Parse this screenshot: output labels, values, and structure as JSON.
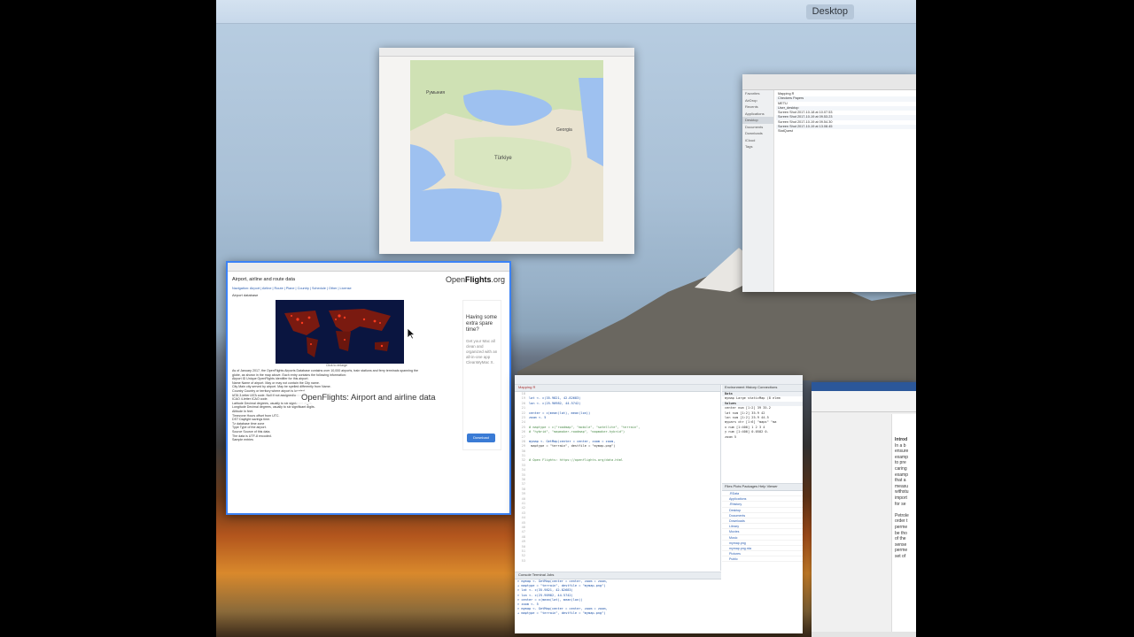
{
  "topbar": {
    "space_label": "Desktop"
  },
  "map_window": {
    "title": "",
    "labels": {
      "turkey": "Türkiye",
      "romania": "Румыния",
      "georgia": "Georgia"
    }
  },
  "finder": {
    "sidebar": [
      "Favorites",
      "AirDrop",
      "Recents",
      "Applications",
      "Desktop",
      "Documents",
      "Downloads",
      "iCloud",
      "Tags"
    ],
    "items": [
      "Mapping R",
      "Checkers Papers",
      "METU",
      "User_desktop",
      "Screen Shot 2017-10-18 at 10.07.53",
      "Screen Shot 2017-10-19 at 09.53.23",
      "Screen Shot 2017-10-19 at 09.54.30",
      "Screen Shot 2017-10-19 at 13.08.45",
      "StatQuest"
    ]
  },
  "openflights": {
    "page_title": "Airport, airline and route data",
    "logo_prefix": "Open",
    "logo_bold": "Flights",
    "logo_suffix": ".org",
    "nav": "Navigation: Airport | Airline | Route | Plane | Country | Schedule | Other | License",
    "section": "Airport database",
    "caption": "Click to enlarge",
    "body_lines": [
      "As of January 2017, the OpenFlights Airports Database contains over 10,000 airports, train stations and ferry terminals spanning the",
      "globe, as shown in the map above. Each entry contains the following information:",
      "Airport ID   Unique OpenFlights identifier for this airport.",
      "Name         Name of airport. May or may not contain the City name.",
      "City         Main city served by airport. May be spelled differently from Name.",
      "Country      Country or territory where airport is located.",
      "IATA         3-letter IATA code. Null if not assigned/unknown.",
      "ICAO         4-letter ICAO code.",
      "Latitude     Decimal degrees, usually to six significant digits.",
      "Longitude    Decimal degrees, usually to six significant digits.",
      "Altitude     In feet.",
      "Timezone     Hours offset from UTC.",
      "DST          Daylight savings time.",
      "Tz database time zone",
      "Type         Type of the airport.",
      "Source       Source of this data.",
      "The data is UTF-8 encoded.",
      "Sample entries"
    ],
    "ad_heading": "Having some extra spare time?",
    "ad_text": "Get your Mac all clean and organized with an all-in-one app CleanMyMac X.",
    "ad_button": "Download",
    "overlay_label": "OpenFlights: Airport and airline data"
  },
  "rstudio": {
    "editor_tab": "Mapping R",
    "code_lines": [
      {
        "n": "18",
        "t": ""
      },
      {
        "n": "19",
        "t": "lat <- c(35.9821, 42.82683)"
      },
      {
        "n": "20",
        "t": "lon <- c(25.90982, 44.5742)"
      },
      {
        "n": "21",
        "t": ""
      },
      {
        "n": "22",
        "t": "center = c(mean(lat), mean(lon))"
      },
      {
        "n": "23",
        "t": "zoom <- 5"
      },
      {
        "n": "24",
        "t": ""
      },
      {
        "n": "25",
        "t": "# maptype = c(\"roadmap\", \"mobile\", \"satellite\", \"terrain\","
      },
      {
        "n": "26",
        "t": "# \"hybrid\", \"mapmaker-roadmap\", \"mapmaker-hybrid\")"
      },
      {
        "n": "27",
        "t": ""
      },
      {
        "n": "28",
        "t": "mymap <- GetMap(center = center, zoom = zoom,"
      },
      {
        "n": "29",
        "t": "              maptype = \"terrain\", destfile = \"mymap.png\")"
      },
      {
        "n": "30",
        "t": ""
      },
      {
        "n": "31",
        "t": ""
      },
      {
        "n": "32",
        "t": "# Open Flights:  https://openflights.org/data.html"
      },
      {
        "n": "33",
        "t": ""
      },
      {
        "n": "34",
        "t": ""
      },
      {
        "n": "35",
        "t": ""
      },
      {
        "n": "36",
        "t": ""
      },
      {
        "n": "37",
        "t": ""
      },
      {
        "n": "38",
        "t": ""
      },
      {
        "n": "39",
        "t": ""
      },
      {
        "n": "40",
        "t": ""
      },
      {
        "n": "41",
        "t": ""
      },
      {
        "n": "42",
        "t": ""
      },
      {
        "n": "43",
        "t": ""
      },
      {
        "n": "44",
        "t": ""
      },
      {
        "n": "45",
        "t": ""
      },
      {
        "n": "46",
        "t": ""
      },
      {
        "n": "47",
        "t": ""
      },
      {
        "n": "48",
        "t": ""
      },
      {
        "n": "49",
        "t": ""
      },
      {
        "n": "50",
        "t": ""
      },
      {
        "n": "51",
        "t": ""
      },
      {
        "n": "52",
        "t": ""
      },
      {
        "n": "53",
        "t": ""
      }
    ],
    "console_tabs": "Console   Terminal   Jobs",
    "console_lines": [
      "> mymap <- GetMap(center = center, zoom = zoom,",
      "+               maptype = \"terrain\", destfile = \"mymap.png\")",
      "> lat <- c(35.9821, 42.82683)",
      "> lon <- c(25.90982, 44.5742)",
      "> center = c(mean(lat), mean(lon))",
      "> zoom <- 5",
      "> mymap <- GetMap(center = center, zoom = zoom,",
      "+               maptype = \"terrain\", destfile = \"mymap.png\")"
    ],
    "env_tabs": "Environment  History  Connections",
    "env_rows": [
      "Data",
      "mymap     Large staticMap (8 elem",
      "Values",
      "center    num [1:2] 39 35.2",
      "lat       num [1:2] 35.9 42",
      "lon       num [1:2] 25.9 44.5",
      "mypars    chr [1:6] \"maps\" \"ma",
      "x         num [1:400] 1 2 3 4",
      "y         num [1:400] 0.0582 0.",
      "zoom      5"
    ],
    "files_tabs": "Files  Plots  Packages  Help  Viewer",
    "files": [
      ".RData",
      "Applications",
      ".Rhistory",
      "Desktop",
      "Documents",
      "Downloads",
      "Library",
      "Movies",
      "Music",
      "mymap.png",
      "mymap.png.rda",
      "Pictures",
      "Public"
    ]
  },
  "word": {
    "lines": [
      "Introd",
      "In a b",
      "ensure",
      "examp",
      "to pre",
      "caring",
      "examp",
      "that a",
      "measu",
      "withstu",
      "import",
      "for se",
      "",
      "Petrole",
      "order t",
      "perme",
      "be tho",
      "of the",
      "sense",
      "perme",
      "set of"
    ]
  }
}
